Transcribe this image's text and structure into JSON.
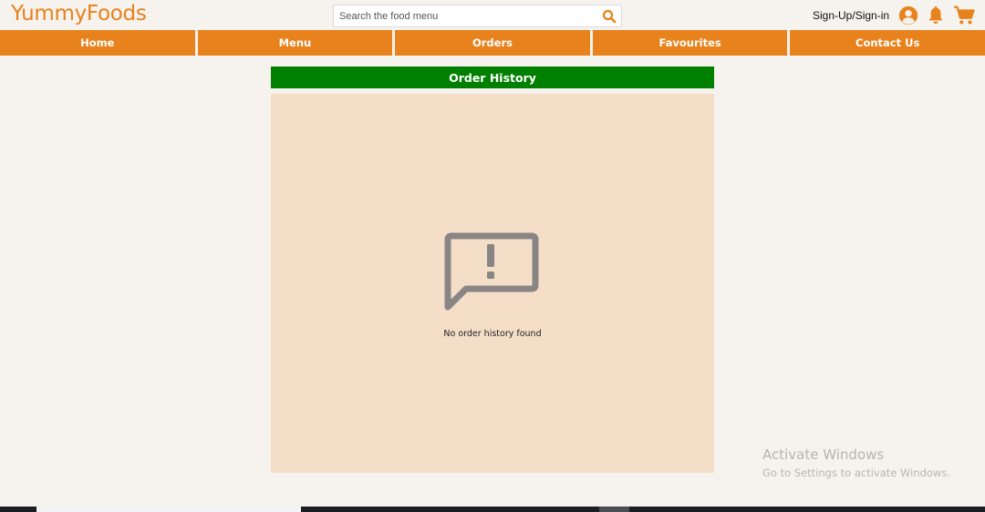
{
  "header": {
    "logo": "YummyFoods",
    "search_placeholder": "Search the food menu",
    "signin_label": "Sign-Up/Sign-in",
    "icons": [
      "search-icon",
      "user-icon",
      "bell-icon",
      "cart-icon"
    ]
  },
  "nav": {
    "items": [
      {
        "label": "Home"
      },
      {
        "label": "Menu"
      },
      {
        "label": "Orders"
      },
      {
        "label": "Favourites"
      },
      {
        "label": "Contact Us"
      }
    ]
  },
  "main": {
    "title": "Order History",
    "empty_message": "No order history found",
    "empty_icon": "message-alert-icon"
  },
  "watermark": {
    "line1": "Activate Windows",
    "line2": "Go to Settings to activate Windows."
  },
  "colors": {
    "brand_orange": "#e8821d",
    "title_green": "#008000",
    "panel_bg": "#f5dec8",
    "page_bg": "#f6f2ed",
    "icon_gray": "#8a8585"
  }
}
